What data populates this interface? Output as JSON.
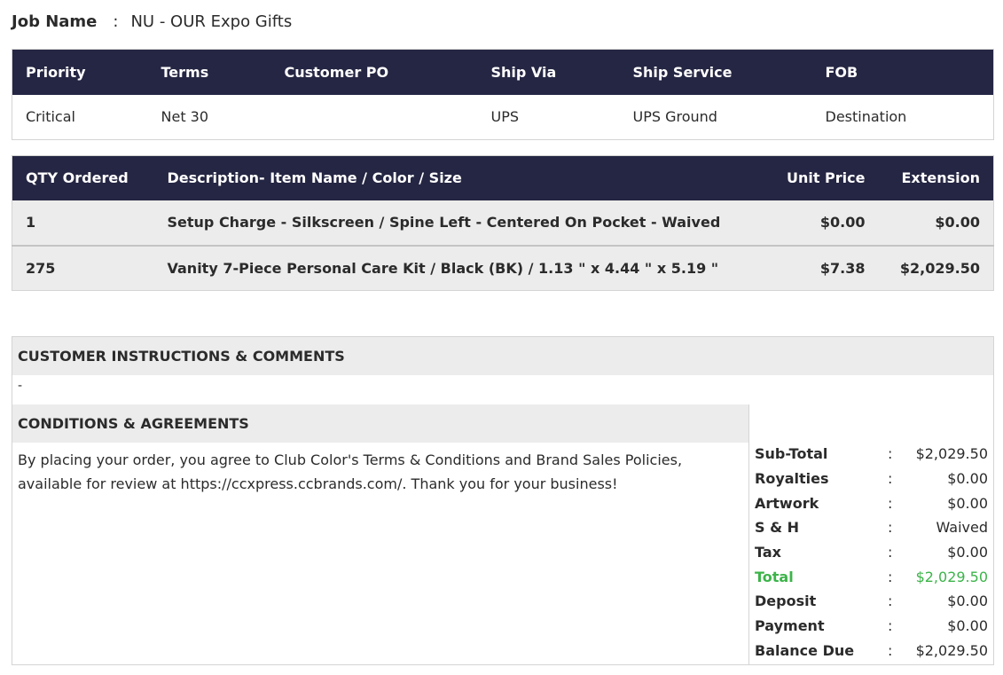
{
  "job": {
    "label": "Job Name",
    "separator": ":",
    "value": "NU - OUR Expo Gifts"
  },
  "order_info": {
    "headers": [
      "Priority",
      "Terms",
      "Customer PO",
      "Ship Via",
      "Ship Service",
      "FOB"
    ],
    "values": [
      "Critical",
      "Net 30",
      "",
      "UPS",
      "UPS Ground",
      "Destination"
    ]
  },
  "items": {
    "headers": [
      "QTY Ordered",
      "Description- Item Name / Color / Size",
      "Unit Price",
      "Extension"
    ],
    "rows": [
      {
        "qty": "1",
        "description": "Setup Charge - Silkscreen / Spine Left - Centered On Pocket - Waived",
        "unit_price": "$0.00",
        "extension": "$0.00"
      },
      {
        "qty": "275",
        "description": "Vanity 7-Piece Personal Care Kit / Black (BK) / 1.13 \" x 4.44 \" x 5.19 \"",
        "unit_price": "$7.38",
        "extension": "$2,029.50"
      }
    ]
  },
  "instructions": {
    "title": "CUSTOMER INSTRUCTIONS & COMMENTS",
    "text": "-"
  },
  "conditions": {
    "title": "CONDITIONS & AGREEMENTS",
    "text": "By placing your order, you agree to Club Color's Terms & Conditions and Brand Sales Policies, available for review at https://ccxpress.ccbrands.com/. Thank you for your business!"
  },
  "totals": [
    {
      "label": "Sub-Total",
      "colon": ":",
      "value": "$2,029.50"
    },
    {
      "label": "Royalties",
      "colon": ":",
      "value": "$0.00"
    },
    {
      "label": "Artwork",
      "colon": ":",
      "value": "$0.00"
    },
    {
      "label": "S & H",
      "colon": ":",
      "value": "Waived"
    },
    {
      "label": "Tax",
      "colon": ":",
      "value": "$0.00"
    },
    {
      "label": "Total",
      "colon": ":",
      "value": "$2,029.50"
    },
    {
      "label": "Deposit",
      "colon": ":",
      "value": "$0.00"
    },
    {
      "label": "Payment",
      "colon": ":",
      "value": "$0.00"
    },
    {
      "label": "Balance Due",
      "colon": ":",
      "value": "$2,029.50"
    }
  ],
  "colors": {
    "header_bg": "#252643",
    "row_bg": "#ececec",
    "total_green": "#3cb449"
  }
}
